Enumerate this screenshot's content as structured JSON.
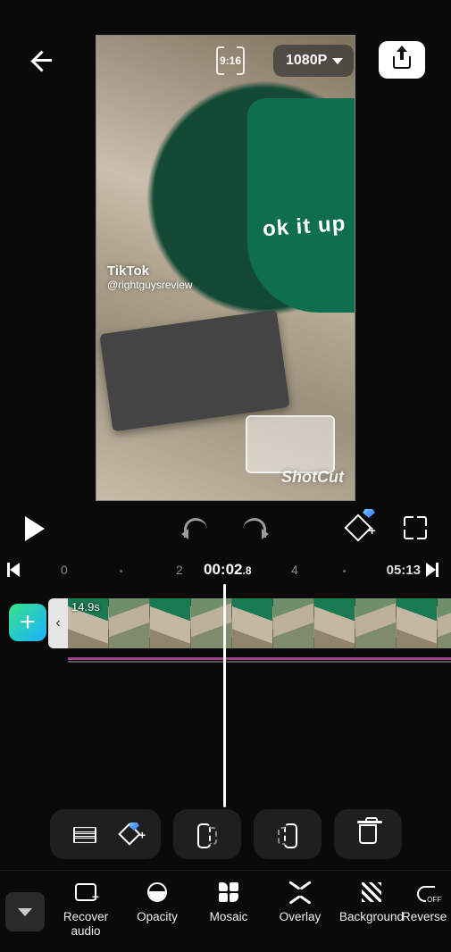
{
  "header": {
    "aspect_label": "9:16",
    "resolution": "1080P"
  },
  "preview": {
    "tiktok_logo": "TikTok",
    "tiktok_handle": "@rightguysreview",
    "apron_text": "ok it up",
    "app_watermark": "ShotCut"
  },
  "ruler": {
    "marks": {
      "m0": "0",
      "m2": "2",
      "m4": "4"
    },
    "current_whole": "00:02",
    "current_dec": ".8",
    "total": "05:13"
  },
  "timeline": {
    "clip_duration": "14.9s",
    "trim_glyph": "‹"
  },
  "bottom_tools": {
    "recover_audio": "Recover audio",
    "opacity": "Opacity",
    "mosaic": "Mosaic",
    "overlay": "Overlay",
    "background": "Background",
    "reverse": "Reverse"
  },
  "icons": {
    "plus": "+"
  }
}
